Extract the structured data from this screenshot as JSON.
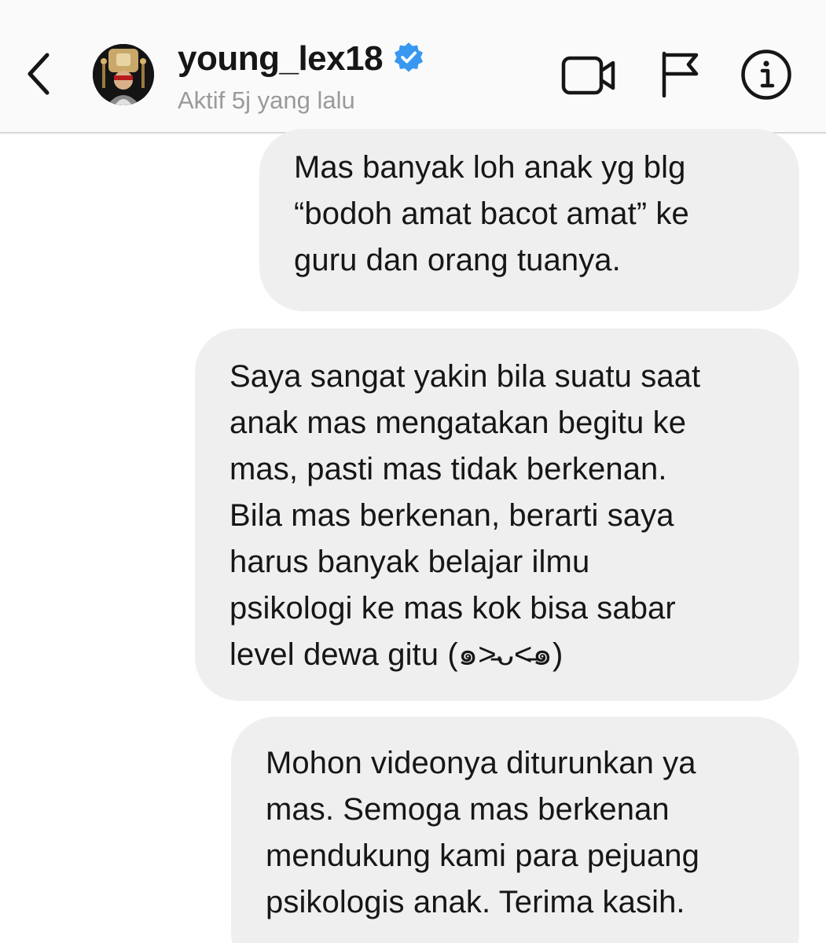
{
  "header": {
    "username": "young_lex18",
    "status": "Aktif 5j yang lalu",
    "icons": {
      "back": "chevron-left-icon",
      "verified": "verified-badge-icon",
      "video": "video-camera-icon",
      "flag": "flag-icon",
      "info": "info-icon"
    },
    "colors": {
      "verified": "#3897f0",
      "status": "#9a9a9a"
    }
  },
  "messages": [
    {
      "text": "Mas banyak loh anak yg blg\n“bodoh amat bacot amat” ke\nguru dan orang tuanya."
    },
    {
      "text": "Saya sangat yakin bila suatu saat\nanak mas mengatakan begitu ke\nmas, pasti mas tidak berkenan.\nBila mas berkenan, berarti saya\nharus banyak belajar ilmu\npsikologi ke mas kok bisa sabar\nlevel dewa gitu (๑˃̵ᴗ˂̵๑)"
    },
    {
      "text": "Mohon videonya diturunkan ya\nmas. Semoga mas berkenan\nmendukung kami para pejuang\npsikologis anak. Terima kasih."
    }
  ],
  "colors": {
    "bubble": "#efefef",
    "header_bg": "#fafafa"
  }
}
